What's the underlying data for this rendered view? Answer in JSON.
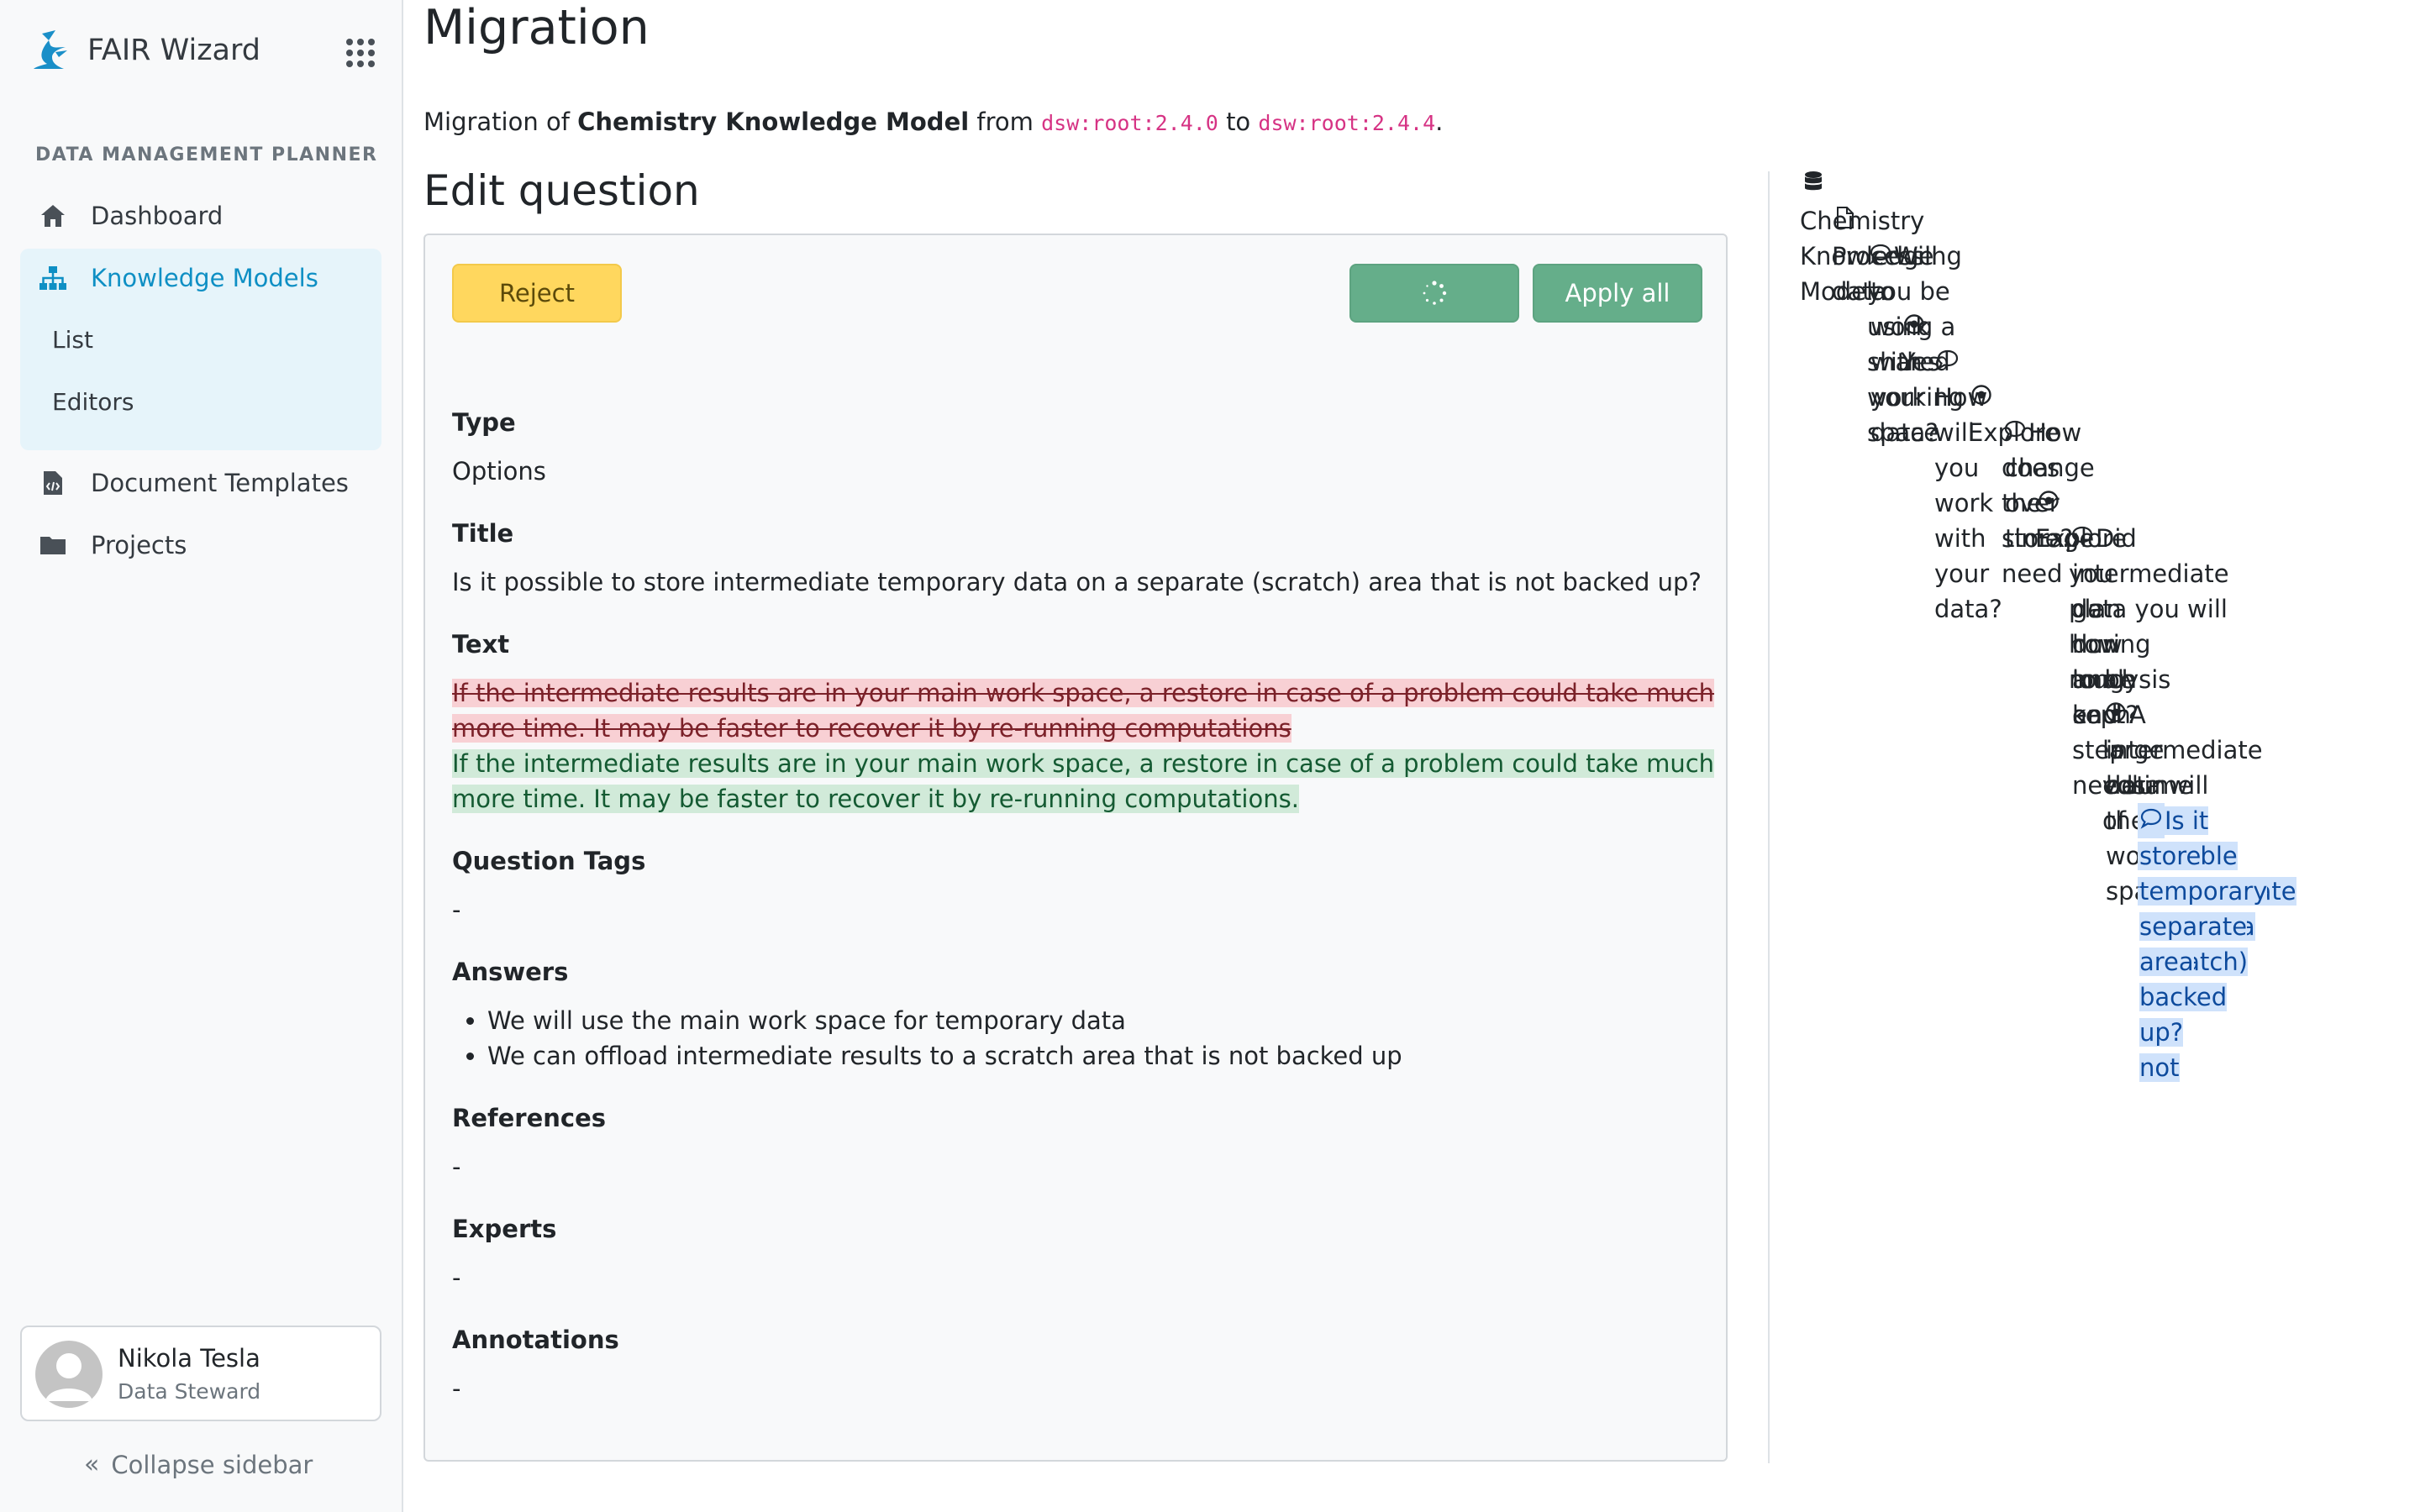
{
  "app": {
    "name": "FAIR Wizard"
  },
  "sidebar": {
    "section_title": "DATA MANAGEMENT PLANNER",
    "items": [
      {
        "label": "Dashboard",
        "icon": "home-icon"
      },
      {
        "label": "Knowledge Models",
        "icon": "sitemap-icon",
        "active": true
      },
      {
        "label": "Document Templates",
        "icon": "file-code-icon"
      },
      {
        "label": "Projects",
        "icon": "folder-icon"
      }
    ],
    "sub_items": [
      {
        "label": "List"
      },
      {
        "label": "Editors"
      }
    ],
    "user": {
      "name": "Nikola Tesla",
      "role": "Data Steward"
    },
    "collapse_label": "Collapse sidebar"
  },
  "main": {
    "title": "Migration",
    "migration": {
      "prefix": "Migration of",
      "km_name": "Chemistry Knowledge Model",
      "from_label": "from",
      "from_id": "dsw:root:2.4.0",
      "to_label": "to",
      "to_id": "dsw:root:2.4.4",
      "suffix": "."
    },
    "section_title": "Edit question",
    "buttons": {
      "reject": "Reject",
      "apply_all": "Apply all"
    },
    "fields": {
      "type_label": "Type",
      "type_value": "Options",
      "title_label": "Title",
      "title_value": "Is it possible to store intermediate temporary data on a separate (scratch) area that is not backed up?",
      "text_label": "Text",
      "text_old_line1": "If the intermediate results are in your main work space, a restore in case of a problem could take much",
      "text_old_line2": "more time. It may be faster to recover it by re-running computations",
      "text_new_line1": "If the intermediate results are in your main work space, a restore in case of a problem could take much",
      "text_new_line2": "more time. It may be faster to recover it by re-running computations.",
      "tags_label": "Question Tags",
      "tags_value": "-",
      "answers_label": "Answers",
      "answers": [
        "We will use the main work space for temporary data",
        "We can offload intermediate results to a scratch area that is not backed up"
      ],
      "references_label": "References",
      "references_value": "-",
      "experts_label": "Experts",
      "experts_value": "-",
      "annotations_label": "Annotations",
      "annotations_value": "-"
    }
  },
  "tree": {
    "root": "Chemistry Knowledge Model",
    "chapter": "Processing data",
    "q1_l1": "Will you be using a shared working space",
    "q1_l2": "to work with your data?",
    "a1": "Yes",
    "q2": "How will you work with your data?",
    "a2": "Explore",
    "q3_l1": "How does the storage need",
    "q3_l2": "change over time?",
    "a3": "Explore",
    "q4_l1": "Did you plan how much",
    "q4_l2": "intermediate data you will",
    "q4_l3": "get during analysis and",
    "q4_l4": "how long each step needs",
    "q4_l5": "to be kept?",
    "a4_l1": "A large volume of",
    "a4_l2": "intermediate data will",
    "a4_l3": "be in the work space",
    "q5_l1": "Is it possible to",
    "q5_l2": "store intermediate",
    "q5_l3": "temporary data on a",
    "q5_l4": "separate (scratch)",
    "q5_l5": "area that is not",
    "q5_l6": "backed up?"
  }
}
